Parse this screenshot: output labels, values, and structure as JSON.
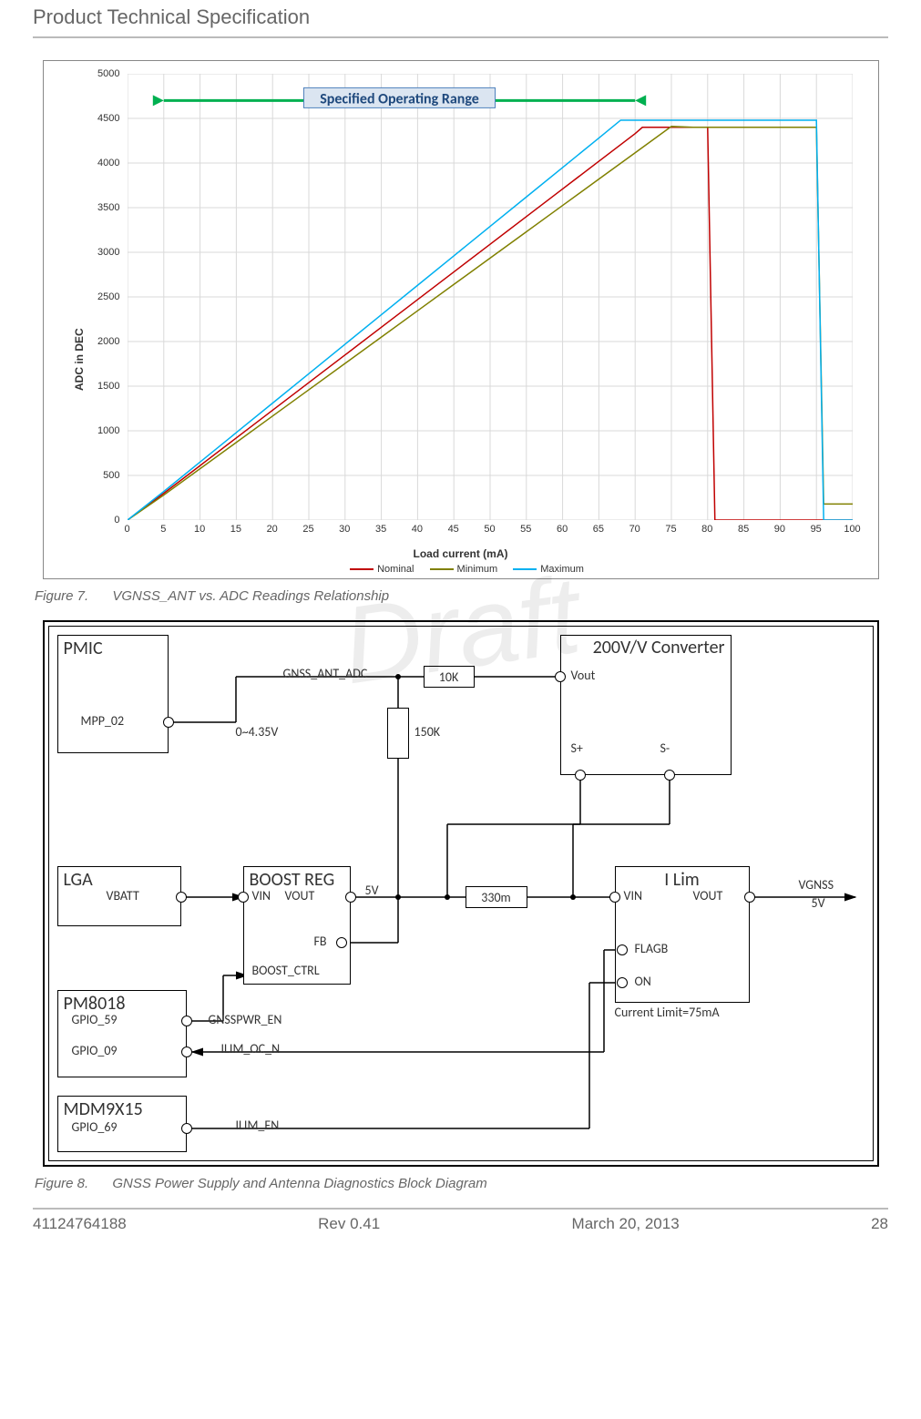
{
  "header": {
    "title": "Product Technical Specification"
  },
  "footer": {
    "docid": "41124764188",
    "rev": "Rev 0.41",
    "date": "March 20, 2013",
    "page": "28"
  },
  "chart_data": {
    "type": "line",
    "title": "",
    "annotation": "Specified Operating Range",
    "annotation_range": [
      5,
      70
    ],
    "xlabel": "Load  current (mA)",
    "ylabel": "ADC  in DEC",
    "xlim": [
      0,
      100
    ],
    "ylim": [
      0,
      5000
    ],
    "xticks": [
      0,
      5,
      10,
      15,
      20,
      25,
      30,
      35,
      40,
      45,
      50,
      55,
      60,
      65,
      70,
      75,
      80,
      85,
      90,
      95,
      100
    ],
    "yticks": [
      0,
      500,
      1000,
      1500,
      2000,
      2500,
      3000,
      3500,
      4000,
      4500,
      5000
    ],
    "series": [
      {
        "name": "Nominal",
        "color": "#c00000",
        "points": [
          [
            0,
            0
          ],
          [
            5,
            300
          ],
          [
            10,
            610
          ],
          [
            15,
            920
          ],
          [
            20,
            1230
          ],
          [
            25,
            1540
          ],
          [
            30,
            1850
          ],
          [
            35,
            2160
          ],
          [
            40,
            2470
          ],
          [
            45,
            2780
          ],
          [
            50,
            3090
          ],
          [
            55,
            3400
          ],
          [
            60,
            3710
          ],
          [
            65,
            4020
          ],
          [
            70,
            4330
          ],
          [
            71,
            4400
          ],
          [
            72,
            4400
          ],
          [
            80,
            4400
          ],
          [
            81,
            0
          ],
          [
            100,
            0
          ]
        ]
      },
      {
        "name": "Minimum",
        "color": "#808000",
        "points": [
          [
            0,
            0
          ],
          [
            5,
            280
          ],
          [
            10,
            575
          ],
          [
            15,
            870
          ],
          [
            20,
            1165
          ],
          [
            25,
            1460
          ],
          [
            30,
            1755
          ],
          [
            35,
            2050
          ],
          [
            40,
            2345
          ],
          [
            45,
            2640
          ],
          [
            50,
            2935
          ],
          [
            55,
            3230
          ],
          [
            60,
            3525
          ],
          [
            65,
            3820
          ],
          [
            70,
            4115
          ],
          [
            75,
            4410
          ],
          [
            78,
            4400
          ],
          [
            95,
            4400
          ],
          [
            96,
            180
          ],
          [
            100,
            180
          ]
        ]
      },
      {
        "name": "Maximum",
        "color": "#00b0f0",
        "points": [
          [
            0,
            0
          ],
          [
            5,
            320
          ],
          [
            10,
            650
          ],
          [
            15,
            980
          ],
          [
            20,
            1310
          ],
          [
            25,
            1640
          ],
          [
            30,
            1970
          ],
          [
            35,
            2300
          ],
          [
            40,
            2630
          ],
          [
            45,
            2960
          ],
          [
            50,
            3290
          ],
          [
            55,
            3620
          ],
          [
            60,
            3950
          ],
          [
            65,
            4280
          ],
          [
            68,
            4480
          ],
          [
            70,
            4480
          ],
          [
            95,
            4480
          ],
          [
            96,
            0
          ],
          [
            100,
            0
          ]
        ]
      }
    ]
  },
  "fig7": {
    "no": "Figure 7.",
    "caption": "VGNSS_ANT vs. ADC Readings Relationship"
  },
  "fig8": {
    "no": "Figure 8.",
    "caption": "GNSS Power Supply and Antenna Diagnostics Block Diagram"
  },
  "diagram": {
    "blocks": {
      "pmic": "PMIC",
      "lga": "LGA",
      "boost": "BOOST REG",
      "pm8018": "PM8018",
      "mdm": "MDM9X15",
      "ilim": "I Lim",
      "conv": "200V/V Converter"
    },
    "pins": {
      "mpp02": "MPP_02",
      "vbatt": "VBATT",
      "gpio59": "GPIO_59",
      "gpio09": "GPIO_09",
      "gpio69": "GPIO_69",
      "vin1": "VIN",
      "vout1": "VOUT",
      "fb": "FB",
      "boost_ctrl": "BOOST_CTRL",
      "vin2": "VIN",
      "vout2": "VOUT",
      "flagb": "FLAGB",
      "on": "ON",
      "vout3": "Vout",
      "splus": "S+",
      "sminus": "S-"
    },
    "signals": {
      "gnss_ant_adc": "GNSS_ANT_ADC",
      "range_v": "0~4.35V",
      "five_v": "5V",
      "gnsspwr_en": "GNSSPWR_EN",
      "ilim_oc_n": "ILIM_OC_N",
      "ilim_en": "ILIM_EN",
      "vgnss": "VGNSS",
      "vgnss5v": "5V",
      "climit": "Current Limit=75mA"
    },
    "components": {
      "r10k": "10K",
      "r150k": "150K",
      "r330m": "330m"
    }
  },
  "watermark": "Draft"
}
